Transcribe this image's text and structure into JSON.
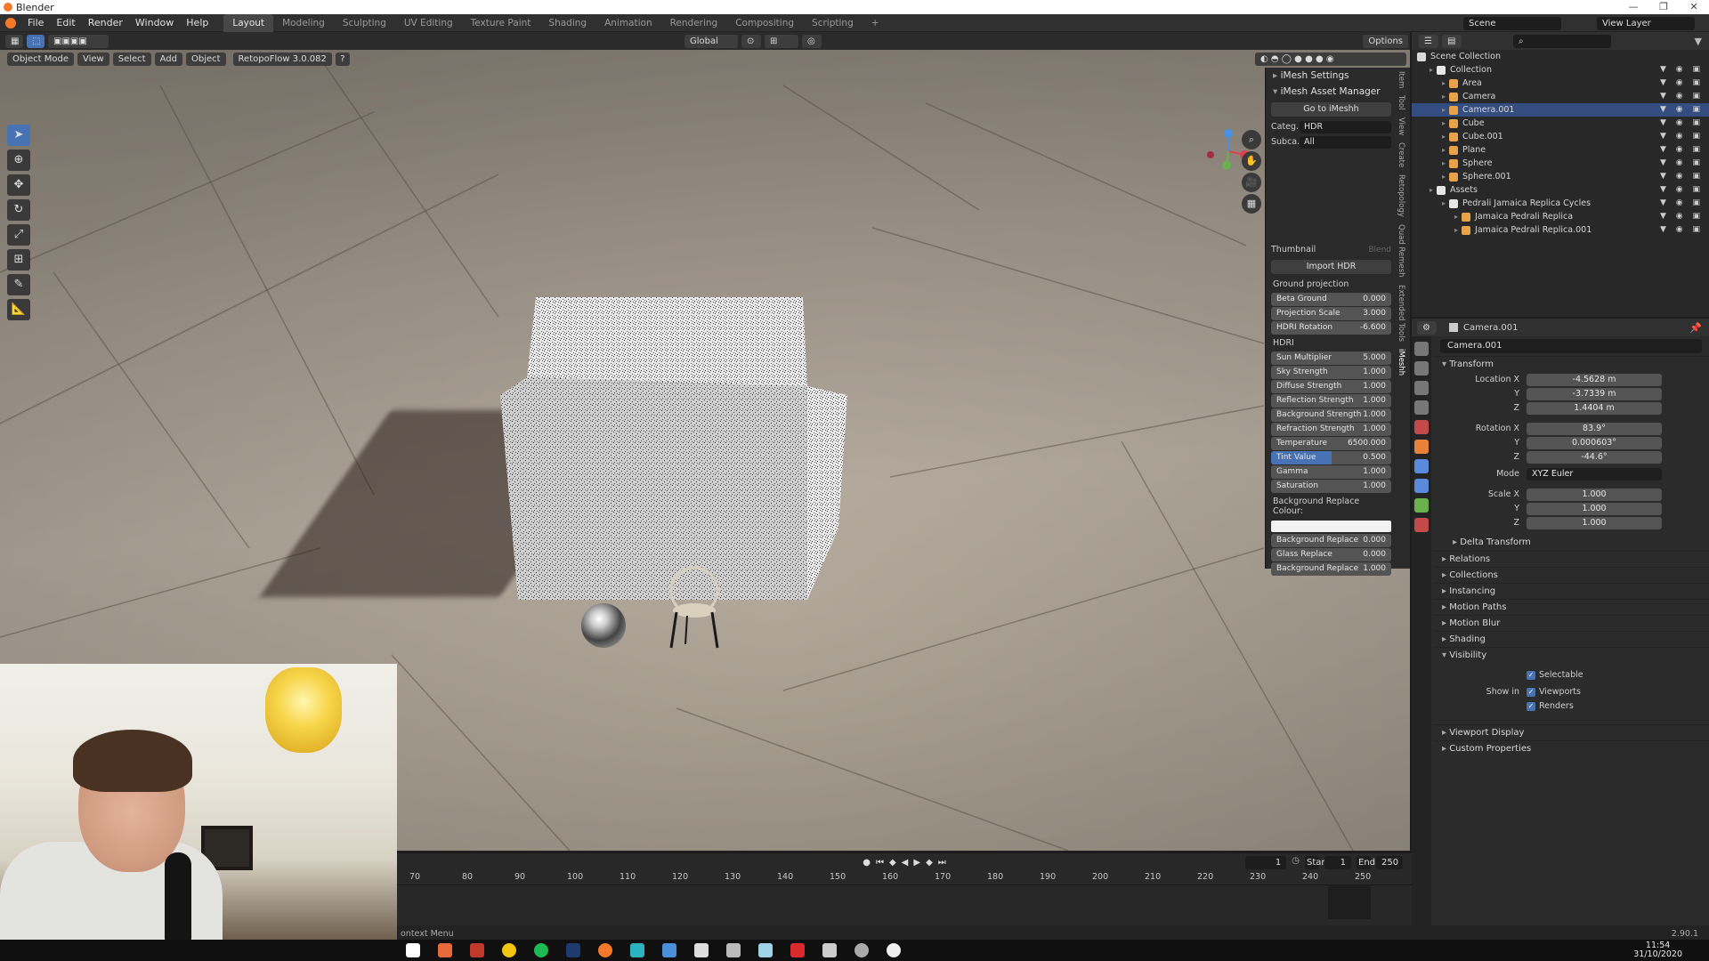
{
  "window": {
    "title": "Blender"
  },
  "menu": {
    "items": [
      "File",
      "Edit",
      "Render",
      "Window",
      "Help"
    ],
    "workspaces": [
      "Layout",
      "Modeling",
      "Sculpting",
      "UV Editing",
      "Texture Paint",
      "Shading",
      "Animation",
      "Rendering",
      "Compositing",
      "Scripting",
      "+"
    ],
    "active_workspace": "Layout",
    "scene": "Scene",
    "view_layer": "View Layer"
  },
  "toolbar": {
    "transform_orientation": "Global",
    "options": "Options"
  },
  "viewport_header": {
    "mode": "Object Mode",
    "view": "View",
    "select": "Select",
    "add": "Add",
    "object": "Object",
    "addon": "RetopoFlow 3.0.082",
    "help": "?"
  },
  "npanel": {
    "imesh_settings": "iMesh Settings",
    "asset_manager": "iMesh Asset Manager",
    "go_button": "Go to iMeshh",
    "category_label": "Categ..",
    "category_value": "HDR",
    "subcategory_label": "Subca..",
    "subcategory_value": "All",
    "thumbnail": "Thumbnail",
    "blend": "Blend",
    "import_button": "Import HDR",
    "ground_projection": "Ground projection",
    "ground_sliders": [
      {
        "label": "Beta Ground Projection",
        "value": "0.000"
      },
      {
        "label": "Projection Scale",
        "value": "3.000"
      },
      {
        "label": "HDRI Rotation",
        "value": "-6.600"
      }
    ],
    "hdri_label": "HDRI",
    "hdri_sliders": [
      {
        "label": "Sun Multiplier",
        "value": "5.000"
      },
      {
        "label": "Sky Strength",
        "value": "1.000"
      },
      {
        "label": "Diffuse Strength",
        "value": "1.000"
      },
      {
        "label": "Reflection Strength",
        "value": "1.000"
      },
      {
        "label": "Background Strength",
        "value": "1.000"
      },
      {
        "label": "Refraction Strength",
        "value": "1.000"
      },
      {
        "label": "Temperature",
        "value": "6500.000"
      },
      {
        "label": "Tint Value",
        "value": "0.500",
        "fill": 0.5
      },
      {
        "label": "Gamma",
        "value": "1.000"
      },
      {
        "label": "Saturation",
        "value": "1.000"
      }
    ],
    "bg_colour_label": "Background Replace Colour:",
    "bg_sliders": [
      {
        "label": "Background Replace",
        "value": "0.000"
      },
      {
        "label": "Glass Replace",
        "value": "0.000"
      },
      {
        "label": "Background Replace",
        "value": "1.000"
      }
    ],
    "tabs": [
      "Item",
      "Tool",
      "View",
      "Create",
      "Retopology",
      "Quad Remesh",
      "Extended Tools",
      "iMeshh"
    ]
  },
  "outliner": {
    "root": "Scene Collection",
    "rows": [
      {
        "name": "Collection",
        "depth": 1,
        "icon": "#e6e6e6"
      },
      {
        "name": "Area",
        "depth": 2,
        "icon": "#e8a24a"
      },
      {
        "name": "Camera",
        "depth": 2,
        "icon": "#e8a24a"
      },
      {
        "name": "Camera.001",
        "depth": 2,
        "icon": "#e8a24a",
        "selected": true
      },
      {
        "name": "Cube",
        "depth": 2,
        "icon": "#e8a24a"
      },
      {
        "name": "Cube.001",
        "depth": 2,
        "icon": "#e8a24a"
      },
      {
        "name": "Plane",
        "depth": 2,
        "icon": "#e8a24a"
      },
      {
        "name": "Sphere",
        "depth": 2,
        "icon": "#e8a24a"
      },
      {
        "name": "Sphere.001",
        "depth": 2,
        "icon": "#e8a24a"
      },
      {
        "name": "Assets",
        "depth": 1,
        "icon": "#e6e6e6"
      },
      {
        "name": "Pedrali Jamaica Replica Cycles",
        "depth": 2,
        "icon": "#e6e6e6"
      },
      {
        "name": "Jamaica Pedrali Replica",
        "depth": 3,
        "icon": "#e8a24a"
      },
      {
        "name": "Jamaica Pedrali Replica.001",
        "depth": 3,
        "icon": "#e8a24a"
      }
    ]
  },
  "properties": {
    "object_name": "Camera.001",
    "object_field": "Camera.001",
    "transform": "Transform",
    "location_label": "Location X",
    "location": [
      "-4.5628 m",
      "-3.7339 m",
      "1.4404 m"
    ],
    "rotation_label": "Rotation X",
    "rotation": [
      "83.9°",
      "0.000603°",
      "-44.6°"
    ],
    "mode_label": "Mode",
    "mode_value": "XYZ Euler",
    "scale_label": "Scale X",
    "scale": [
      "1.000",
      "1.000",
      "1.000"
    ],
    "axis_y": "Y",
    "axis_z": "Z",
    "delta": "Delta Transform",
    "sections": [
      "Relations",
      "Collections",
      "Instancing",
      "Motion Paths",
      "Motion Blur",
      "Shading",
      "Visibility"
    ],
    "selectable": "Selectable",
    "show_in": "Show in",
    "viewports": "Viewports",
    "renders": "Renders",
    "bottom_sections": [
      "Viewport Display",
      "Custom Properties"
    ]
  },
  "timeline": {
    "current_frame": "1",
    "start_label": "Start",
    "start": "1",
    "end_label": "End",
    "end": "250",
    "ticks": [
      "70",
      "80",
      "90",
      "100",
      "110",
      "120",
      "130",
      "140",
      "150",
      "160",
      "170",
      "180",
      "190",
      "200",
      "210",
      "220",
      "230",
      "240",
      "250"
    ]
  },
  "status": {
    "left": "ontext Menu",
    "version": "2.90.1"
  },
  "taskbar": {
    "time": "11:54",
    "date": "31/10/2020"
  }
}
